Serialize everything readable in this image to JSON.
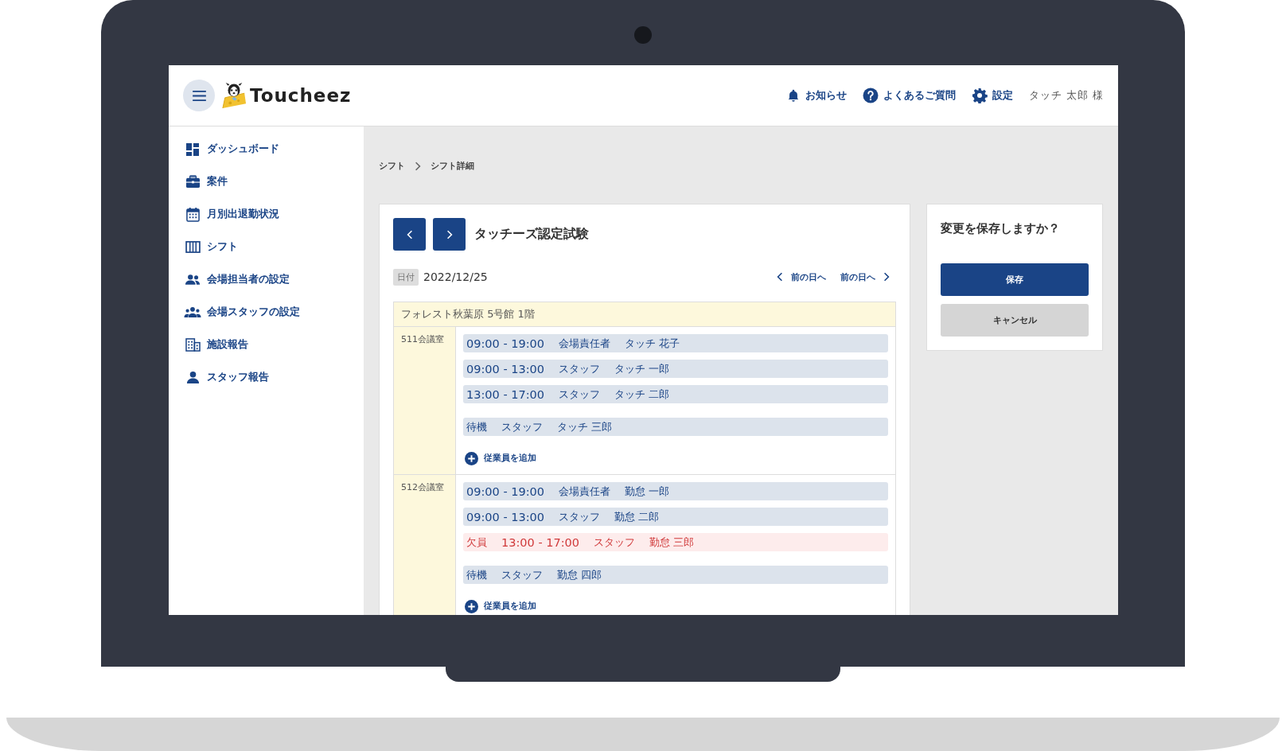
{
  "header": {
    "logo_text": "Toucheez",
    "links": [
      {
        "label": "お知らせ"
      },
      {
        "label": "よくあるご質問"
      },
      {
        "label": "設定"
      }
    ],
    "user": "タッチ 太郎 様"
  },
  "sidebar": {
    "items": [
      {
        "label": "ダッシュボード"
      },
      {
        "label": "案件"
      },
      {
        "label": "月別出退勤状況"
      },
      {
        "label": "シフト"
      },
      {
        "label": "会場担当者の設定"
      },
      {
        "label": "会場スタッフの設定"
      },
      {
        "label": "施設報告"
      },
      {
        "label": "スタッフ報告"
      }
    ]
  },
  "breadcrumb": [
    "シフト",
    "シフト詳細"
  ],
  "shift": {
    "title": "タッチーズ認定試験",
    "date_label": "日付",
    "date": "2022/12/25",
    "prev_day": "前の日へ",
    "next_day": "前の日へ",
    "venue": "フォレスト秋葉原 5号館 1階",
    "rooms": [
      {
        "name": "511会議室",
        "add_label": "従業員を追加",
        "entries": [
          {
            "kind": "shift",
            "time": "09:00 - 19:00",
            "role": "会場責任者",
            "name": "タッチ 花子"
          },
          {
            "kind": "shift",
            "time": "09:00 - 13:00",
            "role": "スタッフ",
            "name": "タッチ 一郎"
          },
          {
            "kind": "shift",
            "time": "13:00 - 17:00",
            "role": "スタッフ",
            "name": "タッチ 二郎"
          },
          {
            "kind": "standby",
            "label": "待機",
            "role": "スタッフ",
            "name": "タッチ 三郎"
          }
        ]
      },
      {
        "name": "512会議室",
        "add_label": "従業員を追加",
        "entries": [
          {
            "kind": "shift",
            "time": "09:00 - 19:00",
            "role": "会場責任者",
            "name": "勤怠 一郎"
          },
          {
            "kind": "shift",
            "time": "09:00 - 13:00",
            "role": "スタッフ",
            "name": "勤怠 二郎"
          },
          {
            "kind": "absent",
            "label": "欠員",
            "time": "13:00 - 17:00",
            "role": "スタッフ",
            "name": "勤怠 三郎"
          },
          {
            "kind": "standby",
            "label": "待機",
            "role": "スタッフ",
            "name": "勤怠 四郎"
          }
        ]
      }
    ]
  },
  "save_panel": {
    "question": "変更を保存しますか？",
    "save": "保存",
    "cancel": "キャンセル"
  }
}
